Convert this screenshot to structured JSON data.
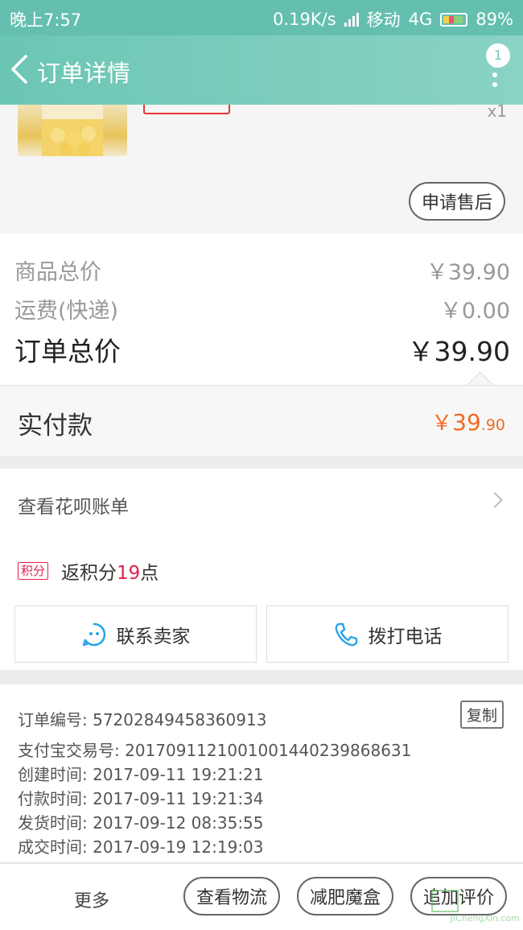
{
  "status_bar": {
    "time": "晚上7:57",
    "net_speed": "0.19K/s",
    "carrier": "移动",
    "network": "4G",
    "battery": "89%"
  },
  "nav": {
    "title": "订单详情",
    "badge_count": "1"
  },
  "product": {
    "quantity": "x1",
    "after_sale_label": "申请售后"
  },
  "totals": {
    "goods_label": "商品总价",
    "goods_value": "￥39.90",
    "shipping_label": "运费(快递)",
    "shipping_value": "￥0.00",
    "order_label": "订单总价",
    "order_value": "￥39.90"
  },
  "paid": {
    "label": "实付款",
    "currency": "￥",
    "integer": "39",
    "decimal": ".90"
  },
  "huabei": {
    "label": "查看花呗账单"
  },
  "points": {
    "tag": "积分",
    "prefix": "返积分",
    "value": "19",
    "suffix": "点"
  },
  "buttons": {
    "contact_seller": "联系卖家",
    "call": "拨打电话"
  },
  "order_info": {
    "copy_label": "复制",
    "lines": [
      "订单编号: 57202849458360913",
      "支付宝交易号: 2017091121001001440239868631",
      "创建时间: 2017-09-11 19:21:21",
      "付款时间: 2017-09-11 19:21:34",
      "发货时间: 2017-09-12 08:35:55",
      "成交时间: 2017-09-19 12:19:03"
    ]
  },
  "action_bar": {
    "more": "更多",
    "logistics": "查看物流",
    "diet_box": "减肥魔盒",
    "add_review": "追加评价"
  },
  "watermark": "JiChengXin.com",
  "colors": {
    "theme": "#6cc6b4",
    "price_orange": "#f26b21",
    "points_red": "#e0224c"
  }
}
